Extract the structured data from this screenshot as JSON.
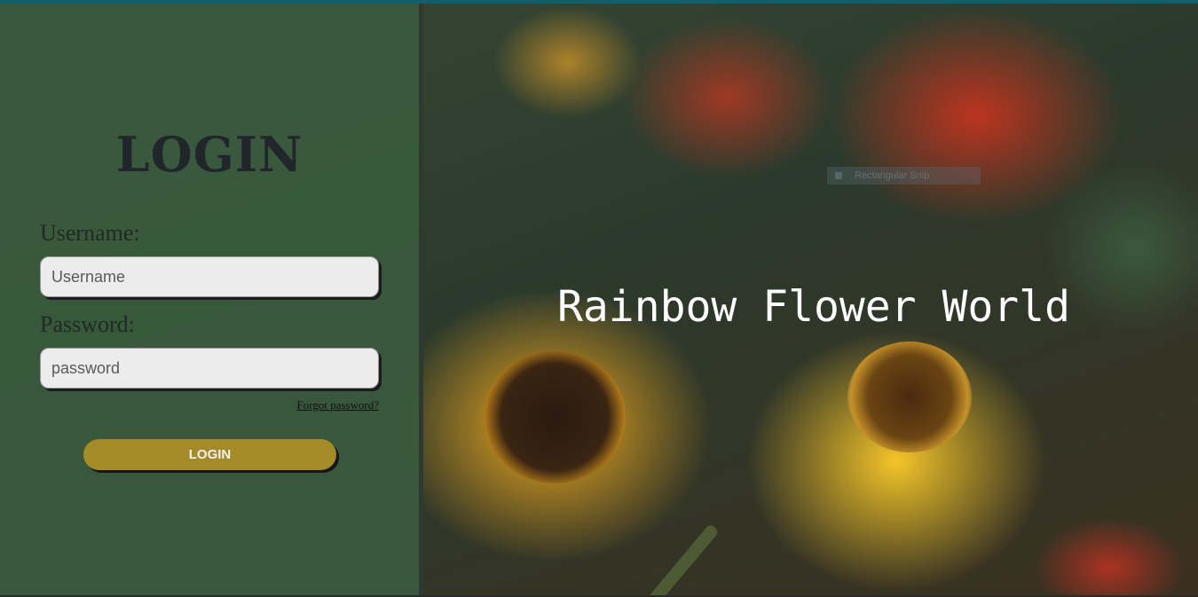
{
  "login_panel": {
    "title": "LOGIN",
    "username_label": "Username:",
    "username_placeholder": "Username",
    "password_label": "Password:",
    "password_placeholder": "password",
    "forgot_password": "Forgot password?",
    "login_button": "LOGIN"
  },
  "hero": {
    "title": "Rainbow Flower World"
  },
  "snip_tooltip": {
    "label": "Rectangular Snip"
  },
  "colors": {
    "panel_green": "#3a5a3e",
    "button_gold": "#a58a2a",
    "top_accent": "#0f5f6d"
  }
}
